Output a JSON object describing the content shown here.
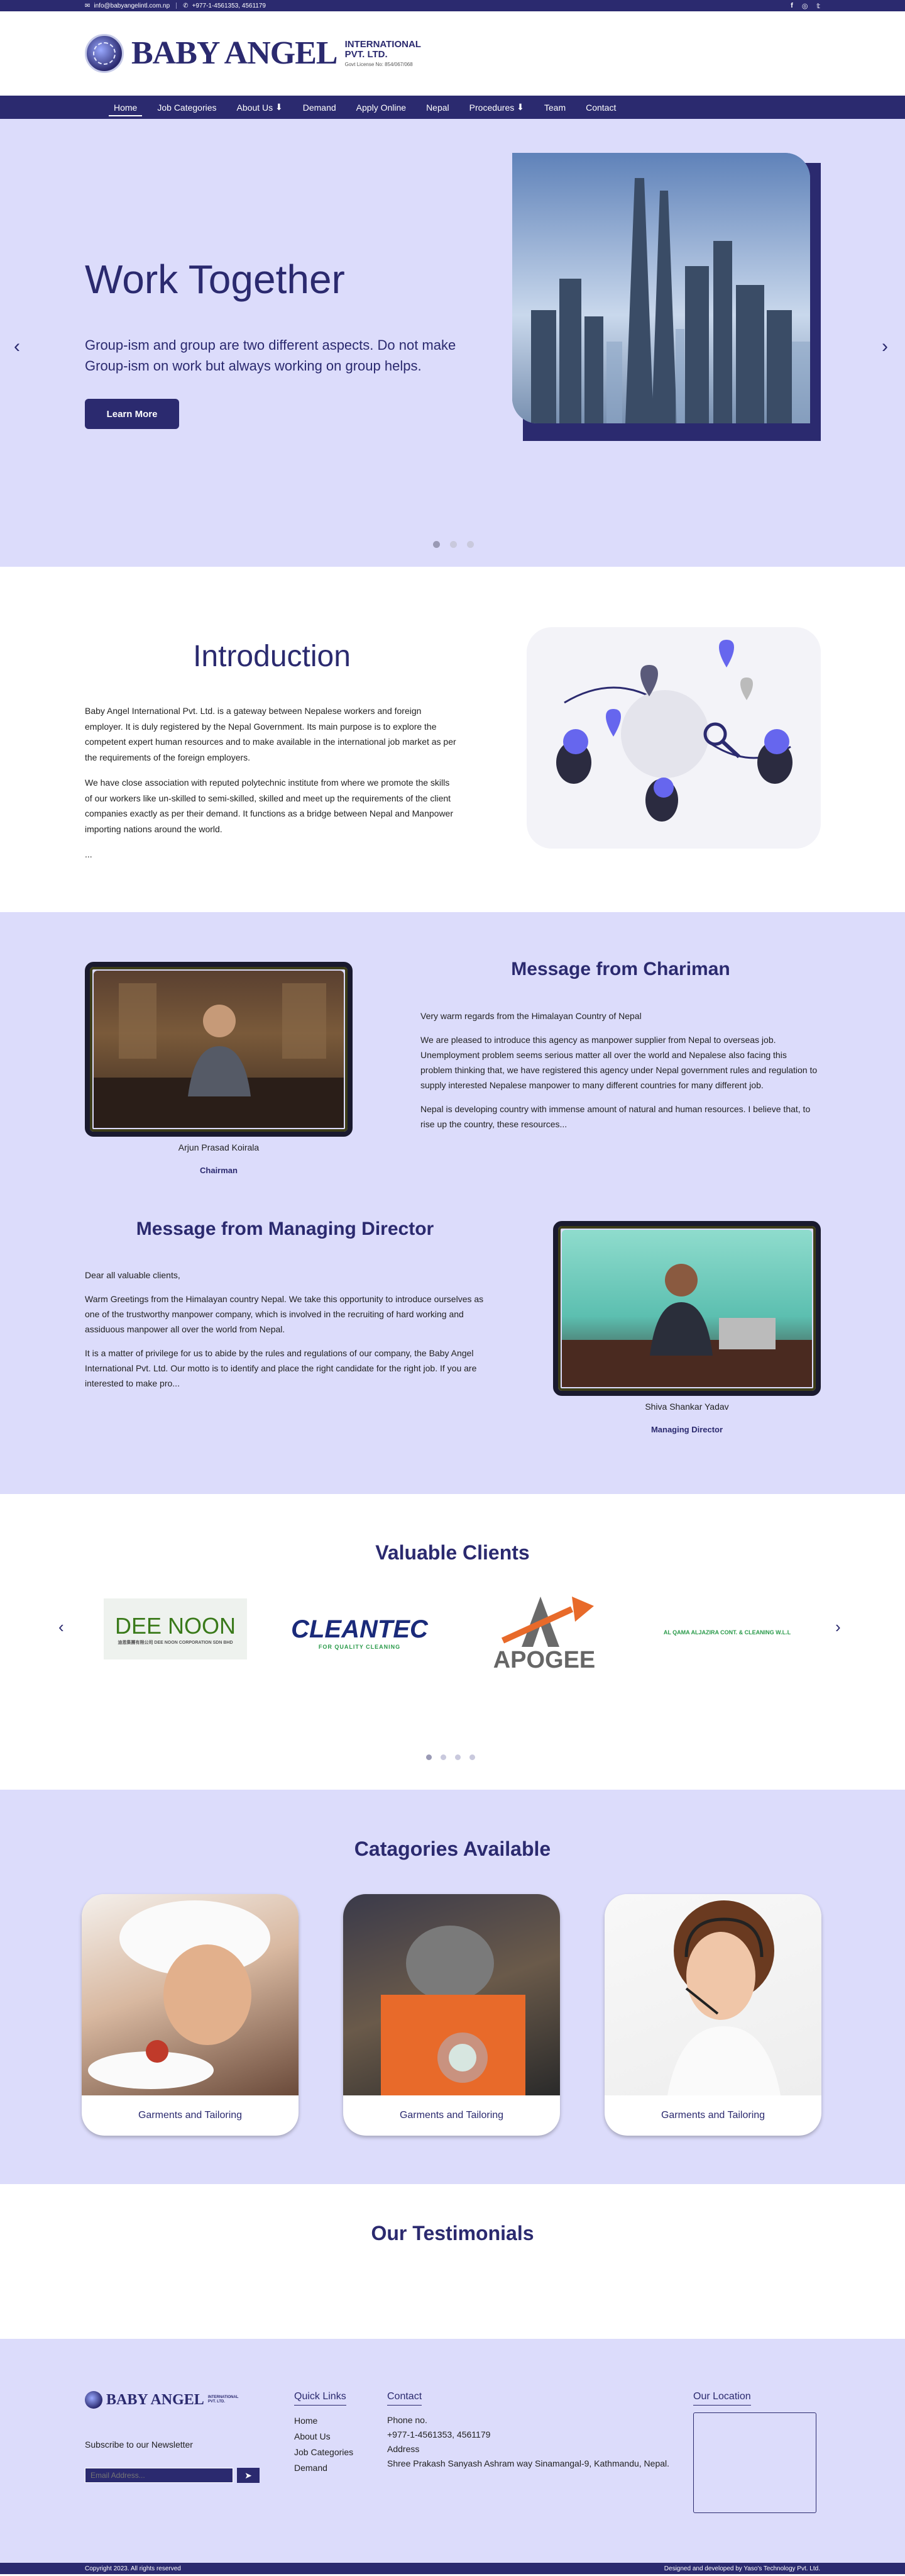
{
  "topbar": {
    "email": "info@babyangelintl.com.np",
    "phone": "+977-1-4561353, 4561179",
    "socials": [
      "facebook-icon",
      "instagram-icon",
      "twitter-icon"
    ]
  },
  "header": {
    "brand": "BABY ANGEL",
    "brand_line1": "INTERNATIONAL",
    "brand_line2": "PVT. LTD.",
    "brand_tag": "Govt License No: 854/067/068"
  },
  "nav": {
    "items": [
      "Home",
      "Job Categories",
      "About Us",
      "Demand",
      "Apply Online",
      "Nepal",
      "Procedures",
      "Team",
      "Contact"
    ],
    "active": "Home"
  },
  "hero": {
    "title": "Work Together",
    "text": "Group-ism and group are two different aspects. Do not make Group-ism on work but always working on group helps.",
    "button": "Learn More",
    "prev": "‹",
    "next": "›"
  },
  "intro": {
    "title": "Introduction",
    "p1": "Baby Angel International Pvt. Ltd. is a gateway between Nepalese workers and foreign employer. It is duly registered by the Nepal Government. Its main purpose is to explore the competent expert human resources and to make available in the international job market as per the requirements of the foreign employers.",
    "p2": "We have close association with reputed polytechnic institute from where we promote the skills of our workers like un-skilled to semi-skilled, skilled and meet up the requirements of the client companies exactly as per their demand. It functions as a bridge between Nepal and Manpower importing nations around the world.",
    "more": "..."
  },
  "chairman": {
    "title": "Message from Chariman",
    "p1": "Very warm regards from the Himalayan Country of Nepal",
    "p2": "We are pleased to introduce this agency as manpower supplier from Nepal to overseas job. Unemployment problem seems serious matter all over the world and Nepalese also facing this problem thinking that, we have registered this agency under Nepal government rules and regulation to supply interested Nepalese manpower to many different countries for many different job.",
    "p3": "Nepal is developing country with immense amount of natural and human resources. I believe that, to rise up the country, these resources...",
    "name": "Arjun Prasad Koirala",
    "role": "Chairman"
  },
  "md": {
    "title": "Message from Managing Director",
    "p1": "Dear all valuable clients,",
    "p2": "Warm Greetings from the Himalayan country Nepal.  We take this opportunity to introduce ourselves as one of the trustworthy manpower company, which is involved in the recruiting of hard working and assiduous manpower all over the world from Nepal.",
    "p3": "It is a matter of privilege for us to abide by the rules and regulations of our company, the Baby Angel International Pvt. Ltd. Our motto is to identify and place the right candidate for the right job. If you are interested to make pro...",
    "name": "Shiva Shankar Yadav",
    "role": "Managing Director"
  },
  "clients": {
    "title": "Valuable Clients",
    "logos": [
      {
        "name": "DEE NOON",
        "sub": "迪恩集團有限公司 DEE NOON CORPORATION SDN BHD"
      },
      {
        "name": "CLEANTEC",
        "sub": "FOR QUALITY CLEANING"
      },
      {
        "name": "APOGEE",
        "sub": ""
      },
      {
        "name": "AL QAMA ALJAZIRA CONT. & CLEANING W.L.L",
        "sub": ""
      }
    ],
    "prev": "‹",
    "next": "›"
  },
  "categories": {
    "title": "Catagories Available",
    "items": [
      "Garments and Tailoring",
      "Garments and Tailoring",
      "Garments and Tailoring"
    ]
  },
  "testimonials": {
    "title": "Our Testimonials"
  },
  "footer": {
    "newsletter_label": "Subscribe to our Newsletter",
    "email_placeholder": "Email Address...",
    "quick_links_title": "Quick Links",
    "quick_links": [
      "Home",
      "About Us",
      "Job Categories",
      "Demand"
    ],
    "contact_title": "Contact",
    "phone_label": "Phone no.",
    "phone": "+977-1-4561353, 4561179",
    "address_label": "Address",
    "address": "Shree Prakash Sanyash Ashram way Sinamangal-9, Kathmandu, Nepal.",
    "location_title": "Our Location"
  },
  "bottombar": {
    "copyright": "Copyright 2023. All rights reserved",
    "credit": "Designed and developed by Yaso's Technology Pvt. Ltd."
  },
  "colors": {
    "primary": "#2b2a6f",
    "light_bg": "#dcdcfb"
  }
}
